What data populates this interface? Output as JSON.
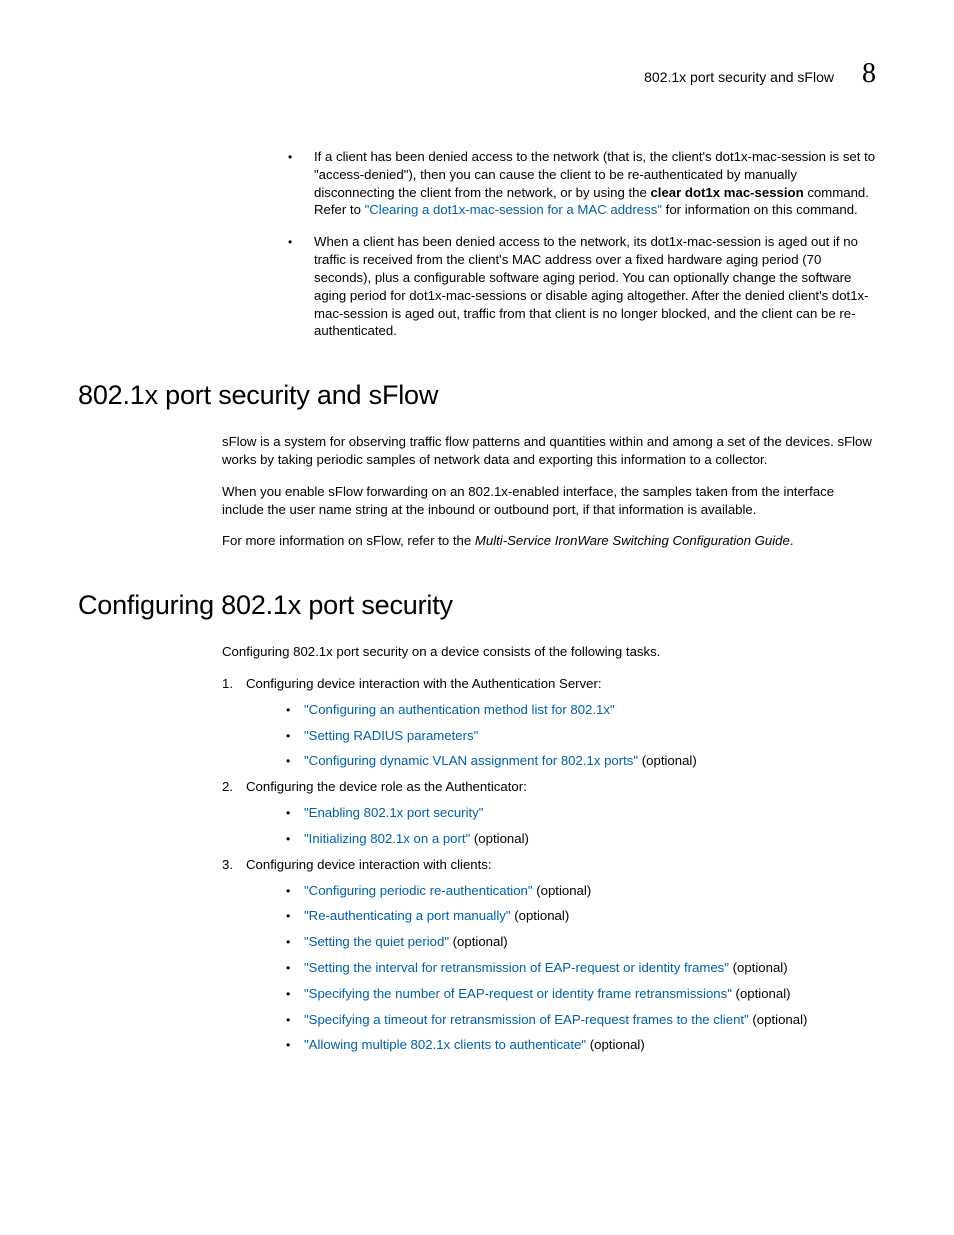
{
  "header": {
    "title": "802.1x port security and sFlow",
    "chapter": "8"
  },
  "intro_bullets": [
    {
      "pre": "If a client has been denied access to the network (that is, the client's dot1x-mac-session is set to \"access-denied\"), then you can cause the client to be re-authenticated by manually disconnecting the client from the network, or by using the ",
      "bold": "clear dot1x mac-session",
      "mid": " command. Refer to ",
      "link": "\"Clearing a dot1x-mac-session for a MAC address\"",
      "post": " for information on this command."
    },
    {
      "text": "When a client has been denied access to the network, its dot1x-mac-session is aged out if no traffic is received from the client's MAC address over a fixed hardware aging period (70 seconds), plus a configurable software aging period. You can optionally change the software aging period for dot1x-mac-sessions or disable aging altogether. After the denied client's dot1x-mac-session is aged out, traffic from that client is no longer blocked, and the client can be re-authenticated."
    }
  ],
  "sections": {
    "sflow": {
      "heading": "802.1x port security and sFlow",
      "p1": "sFlow is a system for observing traffic flow patterns and quantities within and among a set of the devices. sFlow works by taking periodic samples of network data and exporting this information to a collector.",
      "p2": "When you enable sFlow forwarding on an 802.1x-enabled interface, the samples taken from the interface include the user name string at the inbound or outbound port, if that information is available.",
      "p3_pre": "For more information on sFlow, refer to the ",
      "p3_italic": "Multi-Service IronWare Switching Configuration Guide",
      "p3_post": "."
    },
    "config": {
      "heading": "Configuring 802.1x port security",
      "intro": "Configuring 802.1x port security on a device consists of the following tasks.",
      "tasks": [
        {
          "num": "1.",
          "label": "Configuring device interaction with the Authentication Server:",
          "items": [
            {
              "link": "\"Configuring an authentication method list  for 802.1x\"",
              "suffix": ""
            },
            {
              "link": "\"Setting RADIUS parameters\"",
              "suffix": ""
            },
            {
              "link": "\"Configuring dynamic VLAN assignment for  802.1x ports\"",
              "suffix": " (optional)"
            }
          ]
        },
        {
          "num": "2.",
          "label": "Configuring the device role as the Authenticator:",
          "items": [
            {
              "link": "\"Enabling 802.1x port security\"",
              "suffix": ""
            },
            {
              "link": "\"Initializing 802.1x on a port\"",
              "suffix": " (optional)"
            }
          ]
        },
        {
          "num": "3.",
          "label": "Configuring device interaction with clients:",
          "items": [
            {
              "link": "\"Configuring periodic re-authentication\"",
              "suffix": " (optional)"
            },
            {
              "link": "\"Re-authenticating a port manually\"",
              "suffix": " (optional)"
            },
            {
              "link": "\"Setting the quiet period\"",
              "suffix": " (optional)"
            },
            {
              "link": "\"Setting the interval for retransmission of EAP-request or identity frames\"",
              "suffix": " (optional)"
            },
            {
              "link": "\"Specifying the number of EAP-request or  identity frame retransmissions\"",
              "suffix": " (optional)"
            },
            {
              "link": "\"Specifying a timeout for retransmission of EAP-request frames to the client\"",
              "suffix": " (optional)"
            },
            {
              "link": "\"Allowing multiple 802.1x clients to authenticate\"",
              "suffix": " (optional)"
            }
          ]
        }
      ]
    }
  }
}
